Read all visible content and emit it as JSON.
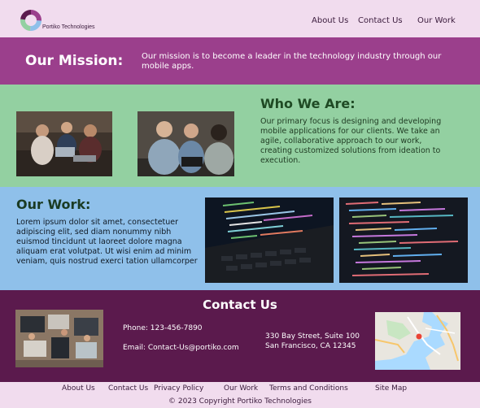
{
  "header": {
    "brand": "Portiko Technologies",
    "nav": [
      "About Us",
      "Contact Us",
      "Our Work"
    ]
  },
  "mission": {
    "title": "Our Mission:",
    "text": "Our mission is to become a leader in the technology industry through our mobile apps."
  },
  "who": {
    "title": "Who We Are:",
    "text": "Our primary focus is designing and developing mobile applications for our clients. We take an agile, collaborative approach to our work, creating customized solutions from ideation to execution."
  },
  "work": {
    "title": "Our Work:",
    "text": "Lorem ipsum dolor sit amet, consectetuer adipiscing elit, sed diam nonummy nibh euismod tincidunt ut laoreet dolore magna aliquam erat volutpat. Ut wisi enim ad minim veniam, quis nostrud exerci tation ullamcorper"
  },
  "contact": {
    "title": "Contact Us",
    "phone": "Phone: 123-456-7890",
    "email": "Email: Contact-Us@portiko.com",
    "address_line1": "330 Bay Street, Suite 100",
    "address_line2": "San Francisco, CA 12345"
  },
  "footer": {
    "links": [
      "About Us",
      "Contact Us",
      "Privacy Policy",
      "Our Work",
      "Terms and Conditions",
      "Site Map"
    ],
    "copyright": "© 2023 Copyright Portiko Technologies"
  },
  "colors": {
    "header_bg": "#f1dcee",
    "mission_bg": "#9b3f8c",
    "who_bg": "#93d0a1",
    "work_bg": "#8fc0ea",
    "contact_bg": "#5b1a4d"
  }
}
